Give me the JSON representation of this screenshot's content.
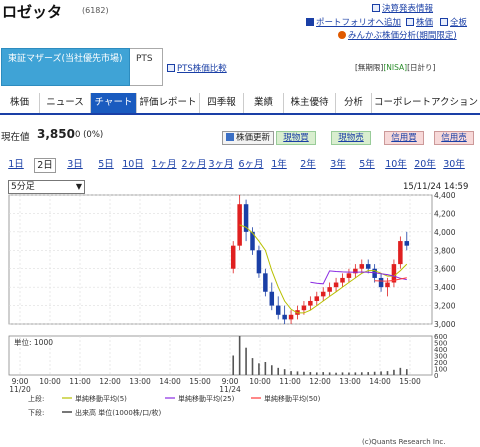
{
  "stock": {
    "name": "ロゼッタ",
    "code": "(6182)"
  },
  "top_links": {
    "kessan": "決算発表情報",
    "portfolio": "ポートフォリオへ追加",
    "kabuka": "株価",
    "kingaku": "全板",
    "minkabu": "みんかぶ株価分析(期間限定)"
  },
  "market": {
    "primary": "東証マザーズ(当社優先市場)",
    "pts": "PTS",
    "pts_compare": "PTS株価比較"
  },
  "badges": {
    "a": "[無期限]",
    "b": "[NISA]",
    "c": "[日計り]"
  },
  "nav": [
    "株価",
    "ニュース",
    "チャート",
    "評価レポート",
    "四季報",
    "業績",
    "株主優待",
    "分析",
    "コーポレートアクション"
  ],
  "quote": {
    "label": "現在値",
    "price": "3,850",
    "change": "0 (0%)",
    "refresh": "株価更新",
    "buttons": [
      "現物買",
      "現物売",
      "信用買",
      "信用売"
    ]
  },
  "ranges": [
    "1日",
    "2日",
    "3日",
    "5日",
    "10日",
    "1ヶ月",
    "2ヶ月",
    "3ヶ月",
    "6ヶ月",
    "1年",
    "2年",
    "3年",
    "5年",
    "10年",
    "20年",
    "30年"
  ],
  "interval": "5分足",
  "timestamp": "15/11/24 14:59",
  "chart_data": {
    "type": "candlestick",
    "y_ticks": [
      "4,400",
      "4,200",
      "4,000",
      "3,800",
      "3,600",
      "3,400",
      "3,200",
      "3,000"
    ],
    "ylim": [
      3000,
      4400
    ],
    "volume_ticks": [
      "600",
      "500",
      "400",
      "300",
      "200",
      "100",
      "0"
    ],
    "volume_unit_label": "単位: 1000",
    "x_ticks": [
      "9:00",
      "10:00",
      "11:00",
      "12:00",
      "13:00",
      "14:00",
      "15:00",
      "9:00",
      "10:00",
      "11:00",
      "12:00",
      "13:00",
      "14:00",
      "15:00"
    ],
    "day_labels": [
      "11/20",
      "11/24"
    ],
    "candles": [
      [
        3600,
        3900,
        3550,
        3850
      ],
      [
        3850,
        4400,
        3800,
        4300
      ],
      [
        4300,
        4350,
        3900,
        4000
      ],
      [
        4000,
        4050,
        3750,
        3800
      ],
      [
        3800,
        3850,
        3500,
        3550
      ],
      [
        3550,
        3600,
        3300,
        3350
      ],
      [
        3350,
        3450,
        3150,
        3200
      ],
      [
        3200,
        3300,
        3050,
        3100
      ],
      [
        3100,
        3200,
        3000,
        3050
      ],
      [
        3050,
        3150,
        3000,
        3100
      ],
      [
        3100,
        3200,
        3050,
        3150
      ],
      [
        3150,
        3250,
        3100,
        3200
      ],
      [
        3200,
        3300,
        3150,
        3250
      ],
      [
        3250,
        3350,
        3200,
        3300
      ],
      [
        3300,
        3400,
        3250,
        3350
      ],
      [
        3350,
        3450,
        3300,
        3400
      ],
      [
        3400,
        3500,
        3350,
        3450
      ],
      [
        3450,
        3550,
        3400,
        3500
      ],
      [
        3500,
        3600,
        3450,
        3550
      ],
      [
        3550,
        3650,
        3500,
        3600
      ],
      [
        3600,
        3700,
        3550,
        3650
      ],
      [
        3650,
        3700,
        3550,
        3600
      ],
      [
        3600,
        3650,
        3450,
        3500
      ],
      [
        3500,
        3550,
        3350,
        3400
      ],
      [
        3400,
        3500,
        3300,
        3450
      ],
      [
        3450,
        3700,
        3400,
        3650
      ],
      [
        3650,
        3950,
        3600,
        3900
      ],
      [
        3900,
        4000,
        3800,
        3850
      ]
    ],
    "volumes": [
      300,
      620,
      420,
      260,
      180,
      200,
      150,
      110,
      90,
      60,
      55,
      50,
      45,
      40,
      45,
      40,
      35,
      40,
      38,
      40,
      42,
      45,
      50,
      55,
      60,
      80,
      110,
      90
    ],
    "legend": {
      "upper": "上段:",
      "ma5": "単純移動平均(5)",
      "ma25": "単純移動平均(25)",
      "ma50": "単純移動平均(50)",
      "lower": "下段:",
      "volume": "出来高 単位(1000株/口/枚)"
    },
    "colors": {
      "up": "#e02020",
      "down": "#1a3fa6",
      "ma5": "#b8c000",
      "ma25": "#8a2be2",
      "ma50": "#ff3a3a"
    }
  },
  "copyright": "(c)Quants Research Inc."
}
